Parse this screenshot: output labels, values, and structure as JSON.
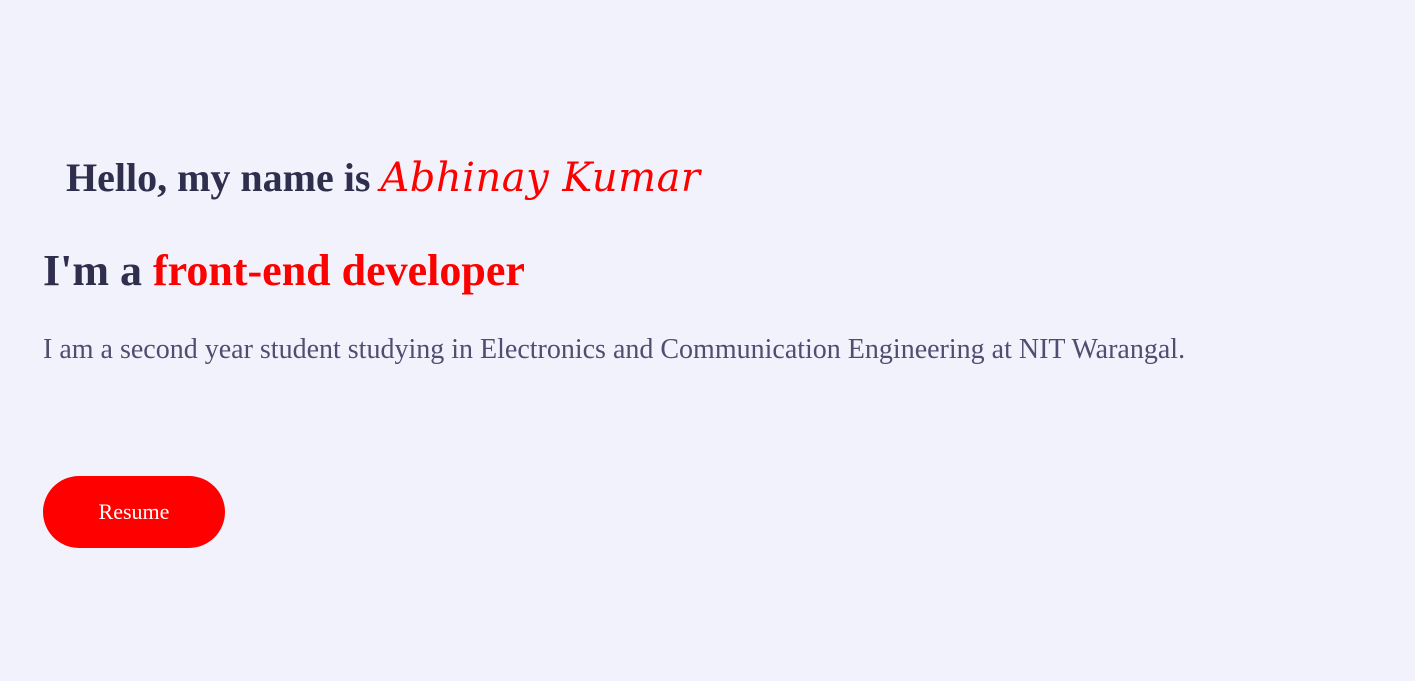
{
  "hero": {
    "greeting_prefix": "Hello, my name is ",
    "name": "Abhinay Kumar",
    "role_prefix": "I'm a ",
    "role_highlight": "front-end developer",
    "bio": "I am a second year student studying in Electronics and Communication Engineering at NIT Warangal.",
    "resume_label": "Resume"
  },
  "colors": {
    "background": "#f2f2fc",
    "heading": "#302e4d",
    "accent": "#ff0000",
    "body_text": "#504e70"
  }
}
